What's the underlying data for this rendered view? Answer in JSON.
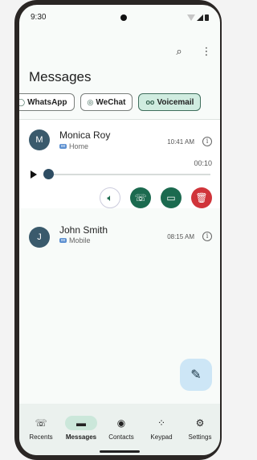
{
  "status": {
    "time": "9:30"
  },
  "topbar": {
    "search_icon": "search-icon",
    "more_icon": "more-vert-icon"
  },
  "page": {
    "title": "Messages"
  },
  "filters": [
    {
      "label": "WhatsApp",
      "icon": "whatsapp-icon",
      "active": false
    },
    {
      "label": "WeChat",
      "icon": "wechat-icon",
      "active": false
    },
    {
      "label": "Voicemail",
      "icon": "voicemail-icon",
      "active": true
    }
  ],
  "messages": [
    {
      "initial": "M",
      "name": "Monica Roy",
      "type": "Home",
      "time": "10:41 AM",
      "duration": "00:10",
      "progress": 0.0,
      "expanded": true
    },
    {
      "initial": "J",
      "name": "John Smith",
      "type": "Mobile",
      "time": "08:15 AM",
      "expanded": false
    }
  ],
  "actions": {
    "speaker_icon": "speaker-icon",
    "call_icon": "phone-icon",
    "message_icon": "message-icon",
    "delete_icon": "trash-icon"
  },
  "fab": {
    "icon": "edit-icon"
  },
  "nav": [
    {
      "label": "Recents",
      "icon": "phone-icon"
    },
    {
      "label": "Messages",
      "icon": "message-icon",
      "active": true
    },
    {
      "label": "Contacts",
      "icon": "account-icon"
    },
    {
      "label": "Keypad",
      "icon": "dialpad-icon"
    },
    {
      "label": "Settings",
      "icon": "gear-icon"
    }
  ],
  "colors": {
    "accent": "#1b6a4f",
    "delete": "#d0343a",
    "avatar": "#3a5a6c",
    "active_chip": "#d0ece0"
  }
}
